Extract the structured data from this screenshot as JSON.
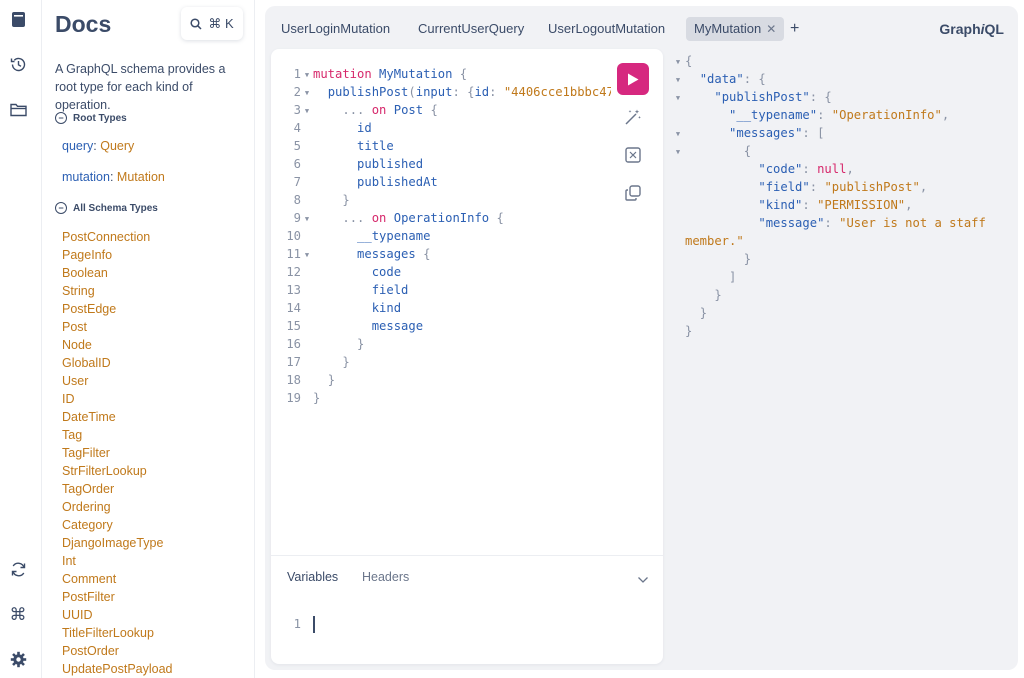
{
  "docs": {
    "title": "Docs",
    "search_shortcut": "⌘ K",
    "description": "A GraphQL schema provides a root type for each kind of operation.",
    "root_types_heading": "Root Types",
    "root_types": [
      {
        "field": "query",
        "type": "Query"
      },
      {
        "field": "mutation",
        "type": "Mutation"
      }
    ],
    "all_types_heading": "All Schema Types",
    "all_types": [
      "PostConnection",
      "PageInfo",
      "Boolean",
      "String",
      "PostEdge",
      "Post",
      "Node",
      "GlobalID",
      "User",
      "ID",
      "DateTime",
      "Tag",
      "TagFilter",
      "StrFilterLookup",
      "TagOrder",
      "Ordering",
      "Category",
      "DjangoImageType",
      "Int",
      "Comment",
      "PostFilter",
      "UUID",
      "TitleFilterLookup",
      "PostOrder",
      "UpdatePostPayload"
    ]
  },
  "tabs": [
    {
      "label": "UserLoginMutation",
      "active": false
    },
    {
      "label": "CurrentUserQuery",
      "active": false
    },
    {
      "label": "UserLogoutMutation",
      "active": false
    },
    {
      "label": "MyMutation",
      "active": true
    }
  ],
  "add_tab_label": "+",
  "brand": {
    "prefix": "Graph",
    "italic": "i",
    "suffix": "QL"
  },
  "query_lines": [
    {
      "n": "1",
      "fold": true,
      "html": "<span class='kw'>mutation</span> <span class='def'>MyMutation</span> <span class='pun'>{</span>"
    },
    {
      "n": "2",
      "fold": true,
      "html": "  <span class='fld'>publishPost</span><span class='pun'>(</span><span class='arg'>input</span><span class='pun'>: {</span><span class='arg'>id</span><span class='pun'>:</span> <span class='str'>\"4406cce1bbbc47\"</span>"
    },
    {
      "n": "3",
      "fold": true,
      "html": "    <span class='pun'>...</span> <span class='kw'>on</span> <span class='typb'>Post</span> <span class='pun'>{</span>"
    },
    {
      "n": "4",
      "fold": false,
      "html": "      <span class='fld'>id</span>"
    },
    {
      "n": "5",
      "fold": false,
      "html": "      <span class='fld'>title</span>"
    },
    {
      "n": "6",
      "fold": false,
      "html": "      <span class='fld'>published</span>"
    },
    {
      "n": "7",
      "fold": false,
      "html": "      <span class='fld'>publishedAt</span>"
    },
    {
      "n": "8",
      "fold": false,
      "html": "    <span class='pun'>}</span>"
    },
    {
      "n": "9",
      "fold": true,
      "html": "    <span class='pun'>...</span> <span class='kw'>on</span> <span class='typb'>OperationInfo</span> <span class='pun'>{</span>"
    },
    {
      "n": "10",
      "fold": false,
      "html": "      <span class='fld'>__typename</span>"
    },
    {
      "n": "11",
      "fold": true,
      "html": "      <span class='fld'>messages</span> <span class='pun'>{</span>"
    },
    {
      "n": "12",
      "fold": false,
      "html": "        <span class='fld'>code</span>"
    },
    {
      "n": "13",
      "fold": false,
      "html": "        <span class='fld'>field</span>"
    },
    {
      "n": "14",
      "fold": false,
      "html": "        <span class='fld'>kind</span>"
    },
    {
      "n": "15",
      "fold": false,
      "html": "        <span class='fld'>message</span>"
    },
    {
      "n": "16",
      "fold": false,
      "html": "      <span class='pun'>}</span>"
    },
    {
      "n": "17",
      "fold": false,
      "html": "    <span class='pun'>}</span>"
    },
    {
      "n": "18",
      "fold": false,
      "html": "  <span class='pun'>}</span>"
    },
    {
      "n": "19",
      "fold": false,
      "html": "<span class='pun'>}</span>"
    }
  ],
  "variables_panel": {
    "tabs": [
      "Variables",
      "Headers"
    ],
    "line_number": "1"
  },
  "result_lines": [
    {
      "fold": true,
      "html": "<span class='rpun'>{</span>"
    },
    {
      "fold": true,
      "html": "  <span class='rkey'>\"data\"</span><span class='rpun'>: {</span>"
    },
    {
      "fold": true,
      "html": "    <span class='rkey'>\"publishPost\"</span><span class='rpun'>: {</span>"
    },
    {
      "fold": false,
      "html": "      <span class='rkey'>\"__typename\"</span><span class='rpun'>:</span> <span class='rstr'>\"OperationInfo\"</span><span class='rpun'>,</span>"
    },
    {
      "fold": true,
      "html": "      <span class='rkey'>\"messages\"</span><span class='rpun'>: [</span>"
    },
    {
      "fold": true,
      "html": "        <span class='rpun'>{</span>"
    },
    {
      "fold": false,
      "html": "          <span class='rkey'>\"code\"</span><span class='rpun'>:</span> <span class='rnull'>null</span><span class='rpun'>,</span>"
    },
    {
      "fold": false,
      "html": "          <span class='rkey'>\"field\"</span><span class='rpun'>:</span> <span class='rstr'>\"publishPost\"</span><span class='rpun'>,</span>"
    },
    {
      "fold": false,
      "html": "          <span class='rkey'>\"kind\"</span><span class='rpun'>:</span> <span class='rstr'>\"PERMISSION\"</span><span class='rpun'>,</span>"
    },
    {
      "fold": false,
      "html": "          <span class='rkey'>\"message\"</span><span class='rpun'>:</span> <span class='rstr'>\"User is not a staff</span>"
    },
    {
      "fold": false,
      "html": "<span class='rstr'>member.\"</span>"
    },
    {
      "fold": false,
      "html": "        <span class='rpun'>}</span>"
    },
    {
      "fold": false,
      "html": "      <span class='rpun'>]</span>"
    },
    {
      "fold": false,
      "html": "    <span class='rpun'>}</span>"
    },
    {
      "fold": false,
      "html": "  <span class='rpun'>}</span>"
    },
    {
      "fold": false,
      "html": "<span class='rpun'>}</span>"
    }
  ],
  "colors": {
    "accent": "#d6287f",
    "keyword": "#d6286b",
    "field": "#2b5fb3",
    "type": "#c0791b",
    "background": "#f1f2f5"
  }
}
